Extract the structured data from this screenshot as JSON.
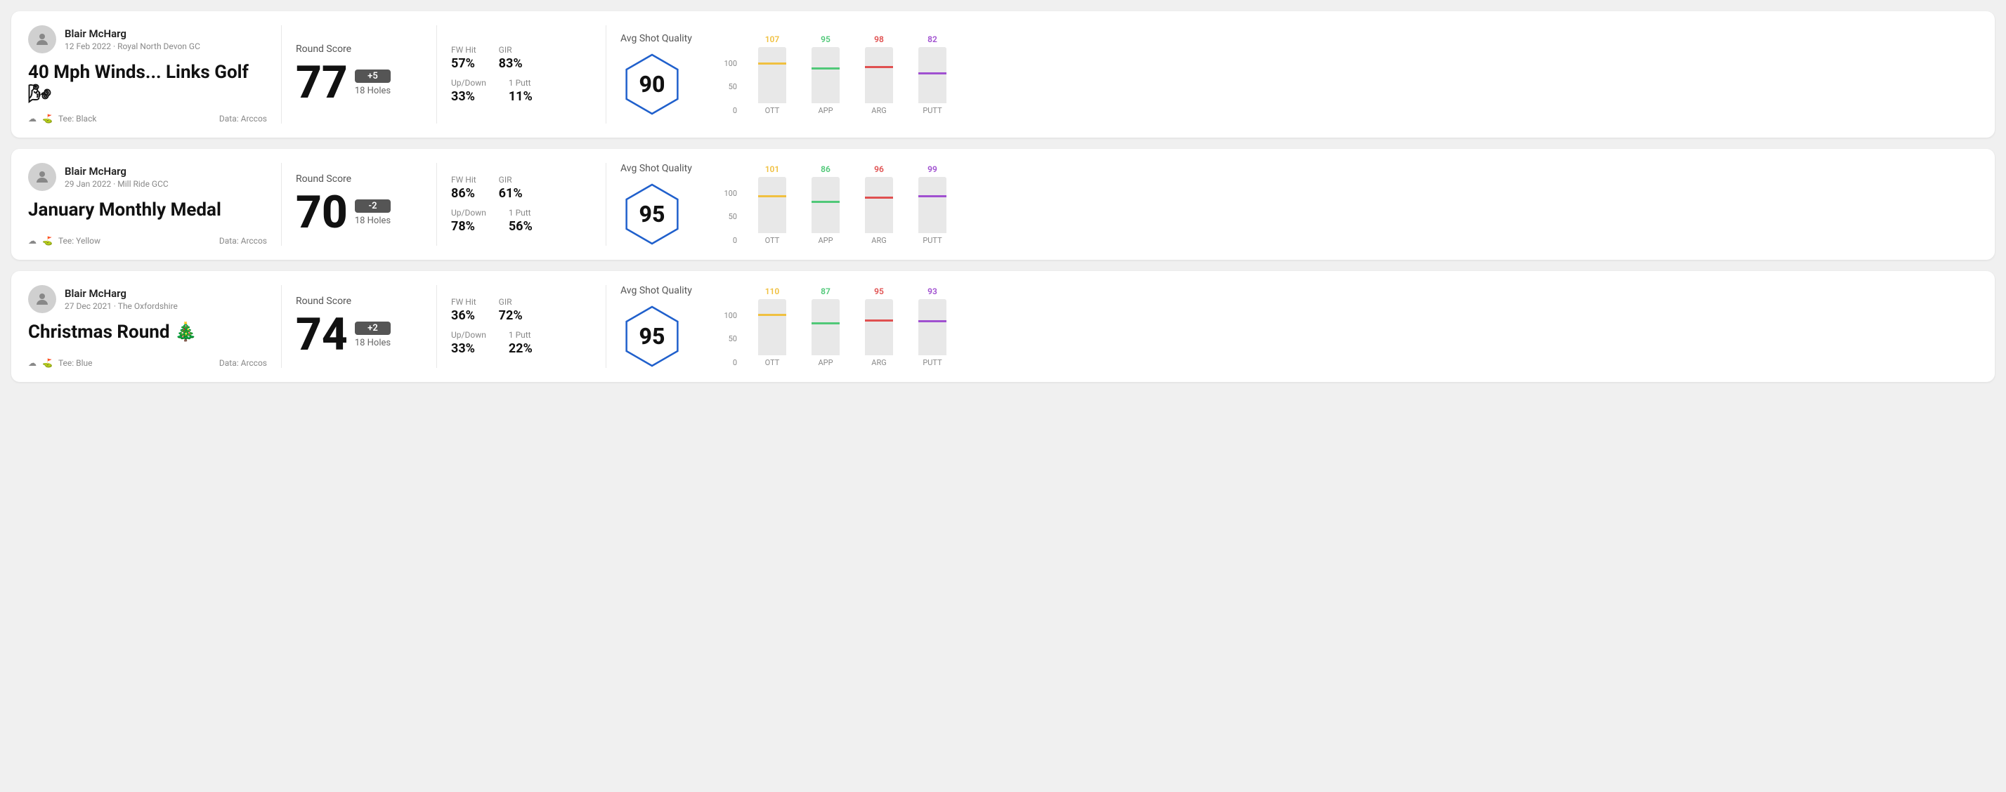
{
  "rounds": [
    {
      "id": "round1",
      "user": {
        "name": "Blair McHarg",
        "date_course": "12 Feb 2022 · Royal North Devon GC"
      },
      "title": "40 Mph Winds... Links Golf 🌬",
      "tee": "Black",
      "data_source": "Data: Arccos",
      "score": {
        "value": "77",
        "badge": "+5",
        "holes": "18 Holes"
      },
      "stats": {
        "fw_hit_label": "FW Hit",
        "fw_hit_value": "57%",
        "gir_label": "GIR",
        "gir_value": "83%",
        "updown_label": "Up/Down",
        "updown_value": "33%",
        "oneputt_label": "1 Putt",
        "oneputt_value": "11%"
      },
      "quality": {
        "label": "Avg Shot Quality",
        "score": "90"
      },
      "chart": {
        "y_labels": [
          "100",
          "50",
          "0"
        ],
        "columns": [
          {
            "label": "OTT",
            "value": 107,
            "color": "#f0c040",
            "bar_pct": 72
          },
          {
            "label": "APP",
            "value": 95,
            "color": "#50c878",
            "bar_pct": 64
          },
          {
            "label": "ARG",
            "value": 98,
            "color": "#e05050",
            "bar_pct": 66
          },
          {
            "label": "PUTT",
            "value": 82,
            "color": "#a050d0",
            "bar_pct": 55
          }
        ]
      }
    },
    {
      "id": "round2",
      "user": {
        "name": "Blair McHarg",
        "date_course": "29 Jan 2022 · Mill Ride GCC"
      },
      "title": "January Monthly Medal",
      "tee": "Yellow",
      "data_source": "Data: Arccos",
      "score": {
        "value": "70",
        "badge": "-2",
        "holes": "18 Holes"
      },
      "stats": {
        "fw_hit_label": "FW Hit",
        "fw_hit_value": "86%",
        "gir_label": "GIR",
        "gir_value": "61%",
        "updown_label": "Up/Down",
        "updown_value": "78%",
        "oneputt_label": "1 Putt",
        "oneputt_value": "56%"
      },
      "quality": {
        "label": "Avg Shot Quality",
        "score": "95"
      },
      "chart": {
        "y_labels": [
          "100",
          "50",
          "0"
        ],
        "columns": [
          {
            "label": "OTT",
            "value": 101,
            "color": "#f0c040",
            "bar_pct": 68
          },
          {
            "label": "APP",
            "value": 86,
            "color": "#50c878",
            "bar_pct": 58
          },
          {
            "label": "ARG",
            "value": 96,
            "color": "#e05050",
            "bar_pct": 65
          },
          {
            "label": "PUTT",
            "value": 99,
            "color": "#a050d0",
            "bar_pct": 67
          }
        ]
      }
    },
    {
      "id": "round3",
      "user": {
        "name": "Blair McHarg",
        "date_course": "27 Dec 2021 · The Oxfordshire"
      },
      "title": "Christmas Round 🎄",
      "tee": "Blue",
      "data_source": "Data: Arccos",
      "score": {
        "value": "74",
        "badge": "+2",
        "holes": "18 Holes"
      },
      "stats": {
        "fw_hit_label": "FW Hit",
        "fw_hit_value": "36%",
        "gir_label": "GIR",
        "gir_value": "72%",
        "updown_label": "Up/Down",
        "updown_value": "33%",
        "oneputt_label": "1 Putt",
        "oneputt_value": "22%"
      },
      "quality": {
        "label": "Avg Shot Quality",
        "score": "95"
      },
      "chart": {
        "y_labels": [
          "100",
          "50",
          "0"
        ],
        "columns": [
          {
            "label": "OTT",
            "value": 110,
            "color": "#f0c040",
            "bar_pct": 74
          },
          {
            "label": "APP",
            "value": 87,
            "color": "#50c878",
            "bar_pct": 59
          },
          {
            "label": "ARG",
            "value": 95,
            "color": "#e05050",
            "bar_pct": 64
          },
          {
            "label": "PUTT",
            "value": 93,
            "color": "#a050d0",
            "bar_pct": 63
          }
        ]
      }
    }
  ]
}
